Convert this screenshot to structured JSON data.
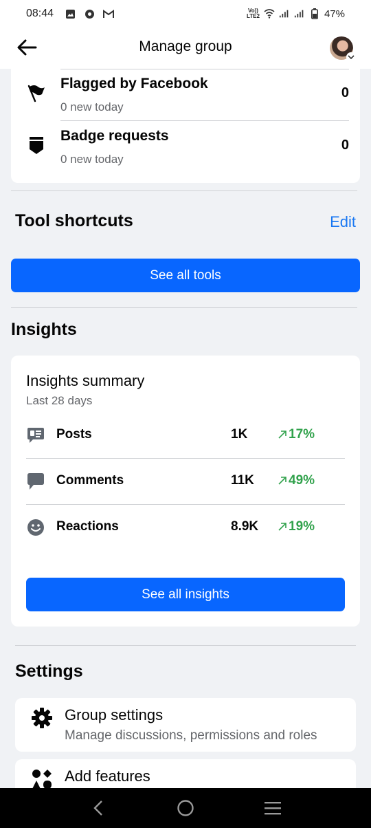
{
  "status_bar": {
    "time": "08:44",
    "network_label": "LTE2",
    "network_top": "Vo))",
    "battery": "47%"
  },
  "header": {
    "title": "Manage group"
  },
  "review": {
    "items": [
      {
        "title": "Flagged by Facebook",
        "subtitle": "0 new today",
        "count": "0"
      },
      {
        "title": "Badge requests",
        "subtitle": "0 new today",
        "count": "0"
      }
    ]
  },
  "tool_shortcuts": {
    "title": "Tool shortcuts",
    "edit_label": "Edit",
    "see_all_label": "See all tools"
  },
  "insights": {
    "title": "Insights",
    "summary_title": "Insights summary",
    "summary_period": "Last 28 days",
    "metrics": [
      {
        "label": "Posts",
        "value": "1K",
        "change": "17%"
      },
      {
        "label": "Comments",
        "value": "11K",
        "change": "49%"
      },
      {
        "label": "Reactions",
        "value": "8.9K",
        "change": "19%"
      }
    ],
    "see_all_label": "See all insights",
    "positive_color": "#31a24c"
  },
  "settings": {
    "title": "Settings",
    "items": [
      {
        "title": "Group settings",
        "subtitle": "Manage discussions, permissions and roles"
      },
      {
        "title": "Add features",
        "subtitle": ""
      }
    ]
  },
  "colors": {
    "accent": "#0866ff",
    "link": "#1877f2",
    "background": "#f0f2f5"
  }
}
